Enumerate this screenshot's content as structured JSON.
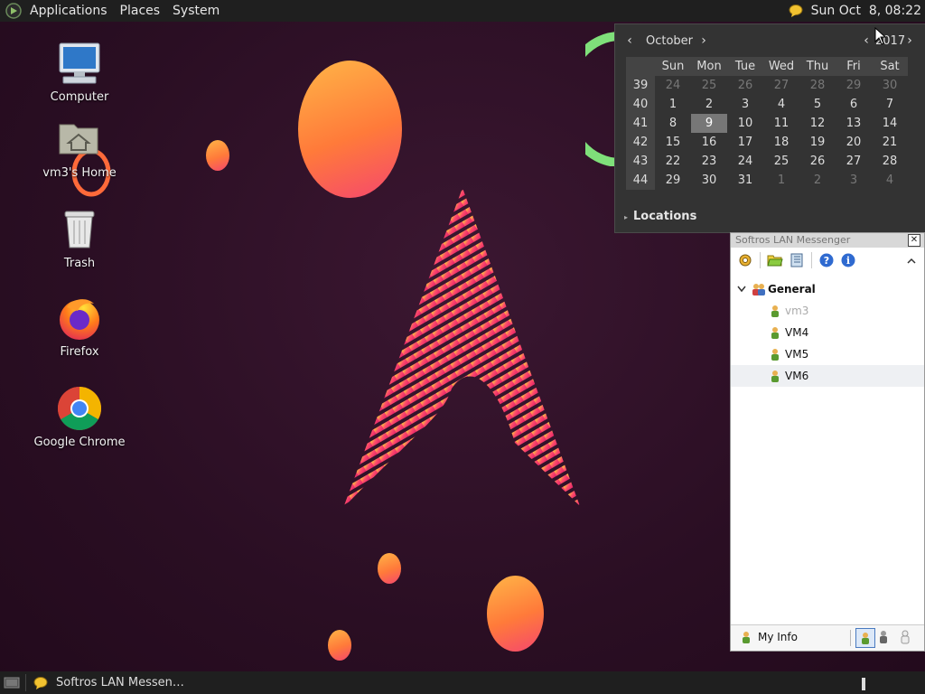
{
  "topbar": {
    "menus": [
      "Applications",
      "Places",
      "System"
    ],
    "clock": "Sun Oct  8, 08:22"
  },
  "desktop_icons": [
    {
      "label": "Computer",
      "icon": "computer-icon"
    },
    {
      "label": "vm3's Home",
      "icon": "home-folder-icon"
    },
    {
      "label": "Trash",
      "icon": "trash-icon"
    },
    {
      "label": "Firefox",
      "icon": "firefox-icon"
    },
    {
      "label": "Google Chrome",
      "icon": "chrome-icon"
    }
  ],
  "calendar": {
    "month": "October",
    "year": "2017",
    "prev_month": "‹",
    "next_month": "›",
    "prev_year": "‹",
    "next_year": "›",
    "day_headers": [
      "Sun",
      "Mon",
      "Tue",
      "Wed",
      "Thu",
      "Fri",
      "Sat"
    ],
    "weeks": [
      {
        "num": "39",
        "days": [
          "24",
          "25",
          "26",
          "27",
          "28",
          "29",
          "30"
        ],
        "other": [
          true,
          true,
          true,
          true,
          true,
          true,
          true
        ]
      },
      {
        "num": "40",
        "days": [
          "1",
          "2",
          "3",
          "4",
          "5",
          "6",
          "7"
        ],
        "other": [
          false,
          false,
          false,
          false,
          false,
          false,
          false
        ]
      },
      {
        "num": "41",
        "days": [
          "8",
          "9",
          "10",
          "11",
          "12",
          "13",
          "14"
        ],
        "other": [
          false,
          false,
          false,
          false,
          false,
          false,
          false
        ]
      },
      {
        "num": "42",
        "days": [
          "15",
          "16",
          "17",
          "18",
          "19",
          "20",
          "21"
        ],
        "other": [
          false,
          false,
          false,
          false,
          false,
          false,
          false
        ]
      },
      {
        "num": "43",
        "days": [
          "22",
          "23",
          "24",
          "25",
          "26",
          "27",
          "28"
        ],
        "other": [
          false,
          false,
          false,
          false,
          false,
          false,
          false
        ]
      },
      {
        "num": "44",
        "days": [
          "29",
          "30",
          "31",
          "1",
          "2",
          "3",
          "4"
        ],
        "other": [
          false,
          false,
          false,
          true,
          true,
          true,
          true
        ]
      }
    ],
    "highlighted_day": "9",
    "locations": "Locations"
  },
  "messenger": {
    "title": "Softros LAN Messenger",
    "group": "General",
    "users": [
      {
        "name": "vm3",
        "self": true
      },
      {
        "name": "VM4",
        "self": false
      },
      {
        "name": "VM5",
        "self": false
      },
      {
        "name": "VM6",
        "self": false
      }
    ],
    "my_info": "My Info"
  },
  "taskbar": {
    "window_label": "Softros LAN Messen…"
  },
  "colors": {
    "topbar_bg": "#1f1f1f",
    "desktop_bg": "#2a0e23",
    "accent_pink": "#f0306e",
    "accent_orange": "#ff8a3a"
  }
}
